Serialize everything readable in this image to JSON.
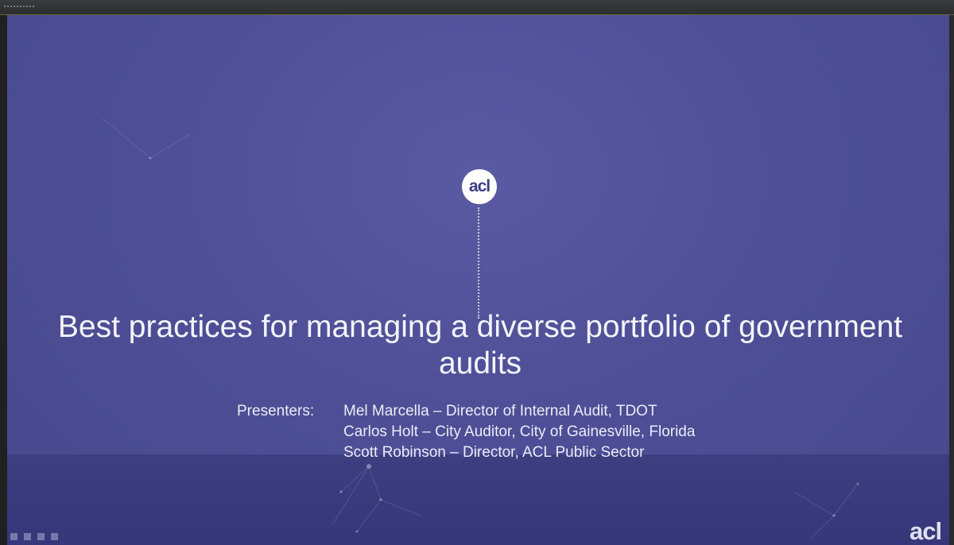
{
  "slide": {
    "logo_text": "acl",
    "title": "Best practices for managing a diverse portfolio of government audits",
    "presenters_label": "Presenters:",
    "presenters": [
      "Mel Marcella – Director of Internal Audit, TDOT",
      "Carlos Holt – City Auditor, City of Gainesville,  Florida",
      "Scott Robinson – Director, ACL Public Sector"
    ],
    "corner_logo_text": "acl"
  },
  "colors": {
    "slide_background": "#4e4f97",
    "bottom_band": "#3d3e80",
    "text": "#f4f4fa",
    "logo_text": "#3b3c85"
  },
  "icons": [
    "pointer-icon",
    "pen-icon",
    "slides-icon",
    "more-icon"
  ]
}
